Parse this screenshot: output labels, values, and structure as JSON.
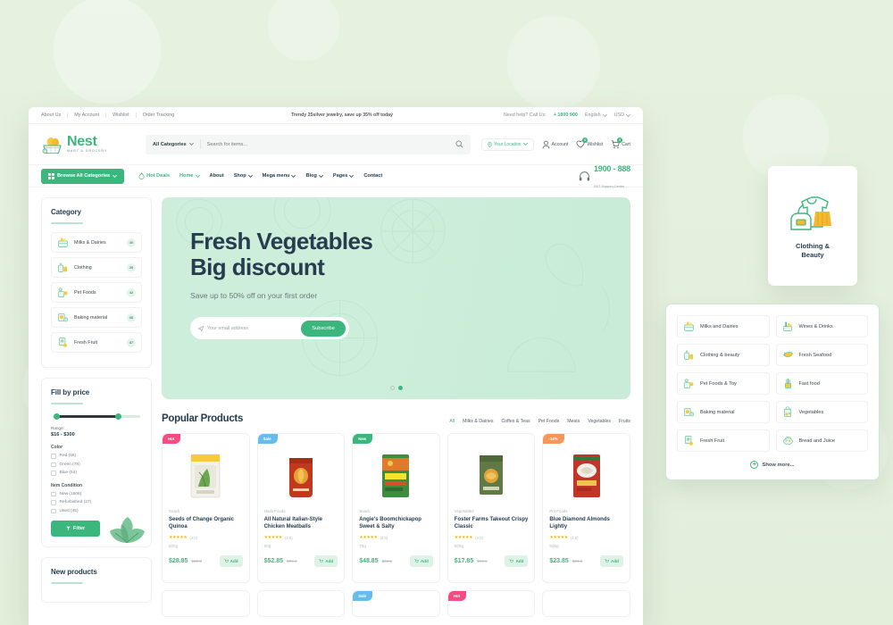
{
  "topbar": {
    "links": [
      "About Us",
      "My Account",
      "Wishlist",
      "Order Tracking"
    ],
    "promo": "Trendy 25silver jewelry, save up 35% off today",
    "need_help": "Need help? Call Us:",
    "phone": "+ 1800 900",
    "language": "English",
    "currency": "USD"
  },
  "header": {
    "brand_name": "Nest",
    "brand_tagline": "MART & GROCERY",
    "search_category": "All Categories",
    "search_placeholder": "Search for items...",
    "location_label": "Your Location",
    "account_label": "Account",
    "wishlist_label": "Wishlist",
    "wishlist_count": "0",
    "cart_label": "Cart",
    "cart_count": "0"
  },
  "nav": {
    "browse_label": "Browse All Categories",
    "items": [
      {
        "label": "Hot Deals",
        "style": "hot",
        "caret": false
      },
      {
        "label": "Home",
        "style": "active",
        "caret": true
      },
      {
        "label": "About",
        "style": "",
        "caret": false
      },
      {
        "label": "Shop",
        "style": "",
        "caret": true
      },
      {
        "label": "Mega menu",
        "style": "",
        "caret": true
      },
      {
        "label": "Blog",
        "style": "",
        "caret": true
      },
      {
        "label": "Pages",
        "style": "",
        "caret": true
      },
      {
        "label": "Contact",
        "style": "",
        "caret": false
      }
    ],
    "support_phone": "1900 - 888",
    "support_sub": "24/7 Support Center"
  },
  "category_panel": {
    "title": "Category",
    "items": [
      {
        "name": "Milks & Dairies",
        "count": "30"
      },
      {
        "name": "Clothing",
        "count": "25"
      },
      {
        "name": "Pet Foods",
        "count": "42"
      },
      {
        "name": "Baking material",
        "count": "68"
      },
      {
        "name": "Fresh Fruit",
        "count": "87"
      }
    ]
  },
  "price_panel": {
    "title": "Fill by price",
    "range_label": "Range:",
    "range_value": "$16 - $300",
    "color_title": "Color",
    "colors": [
      "Red (56)",
      "Green (78)",
      "Blue (54)"
    ],
    "condition_title": "Item Condition",
    "conditions": [
      "New (1506)",
      "Refurbished (27)",
      "Used (45)"
    ],
    "filter_button": "Filter"
  },
  "new_products_panel": {
    "title": "New products"
  },
  "banner": {
    "title_line1": "Fresh Vegetables",
    "title_line2": "Big discount",
    "subtitle": "Save up to 50% off on your first order",
    "email_placeholder": "Your email address",
    "subscribe_label": "Subscribe",
    "active_dot": 2,
    "dot_count": 2
  },
  "popular": {
    "heading": "Popular Products",
    "tabs": [
      "All",
      "Milks & Dairies",
      "Coffes & Teas",
      "Pet Foods",
      "Meats",
      "Vegetables",
      "Fruits"
    ],
    "active_tab": "All",
    "products": [
      {
        "badge": "Hot",
        "badge_style": "b-hot",
        "category": "Snack",
        "name": "Seeds of Change Organic Quinoa",
        "rating": "(4.0)",
        "stars": 4,
        "weight": "500g",
        "price": "$28.85",
        "old_price": "$32.8",
        "add_label": "Add"
      },
      {
        "badge": "Sale",
        "badge_style": "b-sale",
        "category": "Hodo Foods",
        "name": "All Natural Italian-Style Chicken Meatballs",
        "rating": "(3.5)",
        "stars": 4,
        "weight": "60g",
        "price": "$52.85",
        "old_price": "$55.8",
        "add_label": "Add"
      },
      {
        "badge": "New",
        "badge_style": "b-new",
        "category": "Snack",
        "name": "Angie's Boomchickapop Sweet & Salty",
        "rating": "(4.0)",
        "stars": 4,
        "weight": "70g",
        "price": "$48.85",
        "old_price": "$52.8",
        "add_label": "Add"
      },
      {
        "badge": "",
        "badge_style": "",
        "category": "Vegetables",
        "name": "Foster Farms Takeout Crispy Classic",
        "rating": "(4.0)",
        "stars": 4,
        "weight": "500g",
        "price": "$17.85",
        "old_price": "$19.6",
        "add_label": "Add"
      },
      {
        "badge": "-14%",
        "badge_style": "b-off",
        "category": "Pet Foods",
        "name": "Blue Diamond Almonds Lightly",
        "rating": "(4.0)",
        "stars": 4,
        "weight": "500g",
        "price": "$23.85",
        "old_price": "$26.6",
        "add_label": "Add"
      }
    ],
    "row2_badges": [
      {
        "badge": "",
        "badge_style": ""
      },
      {
        "badge": "",
        "badge_style": ""
      },
      {
        "badge": "Sale",
        "badge_style": "b-sale"
      },
      {
        "badge": "Hot",
        "badge_style": "b-hot"
      },
      {
        "badge": "",
        "badge_style": ""
      }
    ]
  },
  "clothing_card": {
    "label_line1": "Clothing &",
    "label_line2": "Beauty"
  },
  "category_dropdown": {
    "items": [
      "Milks and Dairies",
      "Wines & Drinks",
      "Clothing & beauty",
      "Fresh Seafood",
      "Pet Foods & Toy",
      "Fast food",
      "Baking material",
      "Vegetables",
      "Fresh Fruit",
      "Bread and Juice"
    ],
    "show_more": "Show more..."
  },
  "colors": {
    "brand_green": "#3bb77e",
    "dark_navy": "#253d4e",
    "hot_pink": "#f74b81",
    "sale_blue": "#67bcee",
    "off_orange": "#f59758",
    "page_bg": "#e3f0dd"
  }
}
